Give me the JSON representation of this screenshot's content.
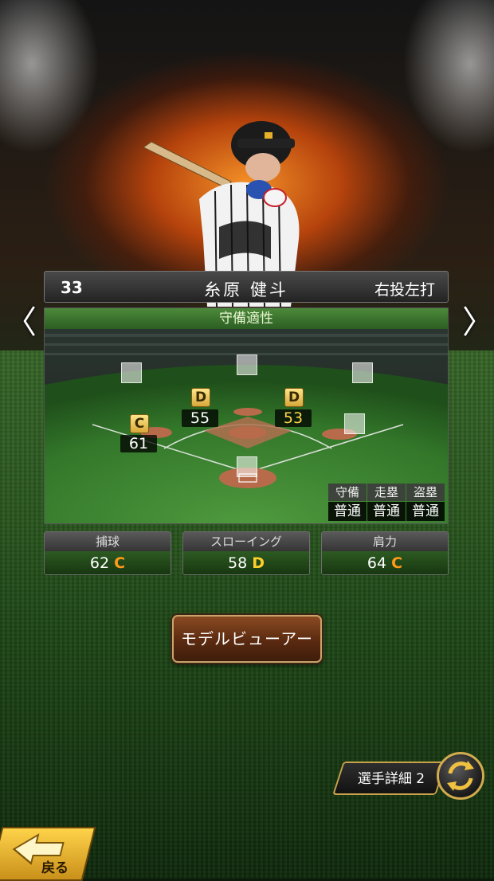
{
  "player": {
    "number": "33",
    "name": "糸原 健斗",
    "handedness": "右投左打"
  },
  "field": {
    "title": "守備適性",
    "positions": [
      {
        "id": "second-base",
        "grade": "D",
        "value": "53",
        "value_color": "yellow"
      },
      {
        "id": "shortstop",
        "grade": "D",
        "value": "55",
        "value_color": "white"
      },
      {
        "id": "third-base",
        "grade": "C",
        "value": "61",
        "value_color": "white"
      }
    ],
    "mini_table": {
      "headers": [
        "守備",
        "走塁",
        "盗塁"
      ],
      "values": [
        "普通",
        "普通",
        "普通"
      ]
    }
  },
  "stats": [
    {
      "label": "捕球",
      "value": "62",
      "grade": "C"
    },
    {
      "label": "スローイング",
      "value": "58",
      "grade": "D"
    },
    {
      "label": "肩力",
      "value": "64",
      "grade": "C"
    }
  ],
  "buttons": {
    "model_viewer": "モデルビューアー",
    "player_detail": "選手詳細 2",
    "back": "戻る"
  },
  "nav": {
    "prev": "〈",
    "next": "〉"
  },
  "colors": {
    "accent_gold": "#d2ab4e",
    "grade_c": "#ff9a1a",
    "grade_d": "#ffcf2a",
    "field_green": "#2c5e23"
  }
}
